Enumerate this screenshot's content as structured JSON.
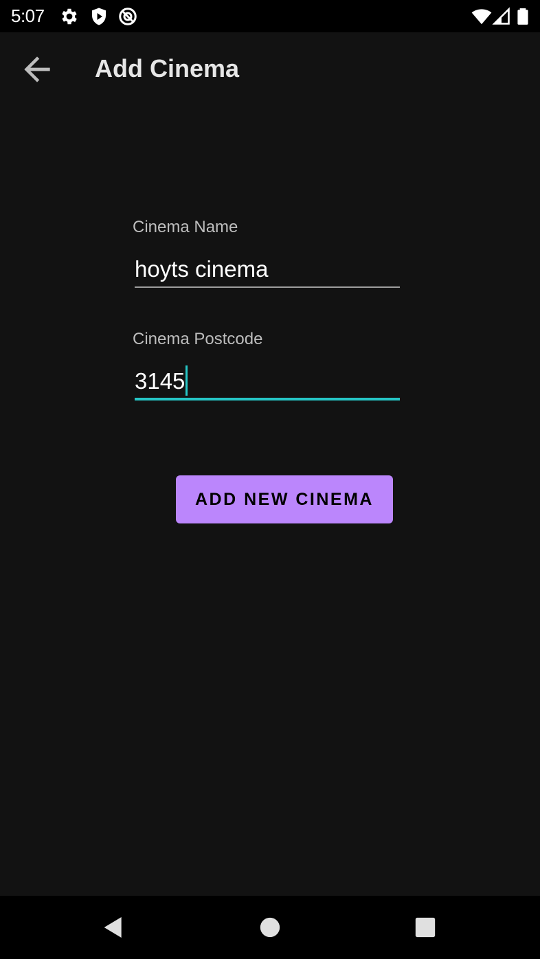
{
  "status_bar": {
    "time": "5:07",
    "icons": [
      "settings-gear-icon",
      "play-protect-icon",
      "do-not-disturb-icon",
      "wifi-icon",
      "cell-signal-icon",
      "battery-icon"
    ]
  },
  "app_bar": {
    "title": "Add Cinema",
    "back_icon": "arrow-back-icon"
  },
  "form": {
    "name_label": "Cinema Name",
    "name_value": "hoyts cinema",
    "postcode_label": "Cinema Postcode",
    "postcode_value": "3145",
    "submit_label": "ADD NEW CINEMA"
  },
  "nav_bar": {
    "icons": [
      "nav-back-icon",
      "nav-home-icon",
      "nav-recents-icon"
    ]
  },
  "colors": {
    "background": "#121212",
    "accent": "#bb86fc",
    "focus": "#26c6c6"
  }
}
